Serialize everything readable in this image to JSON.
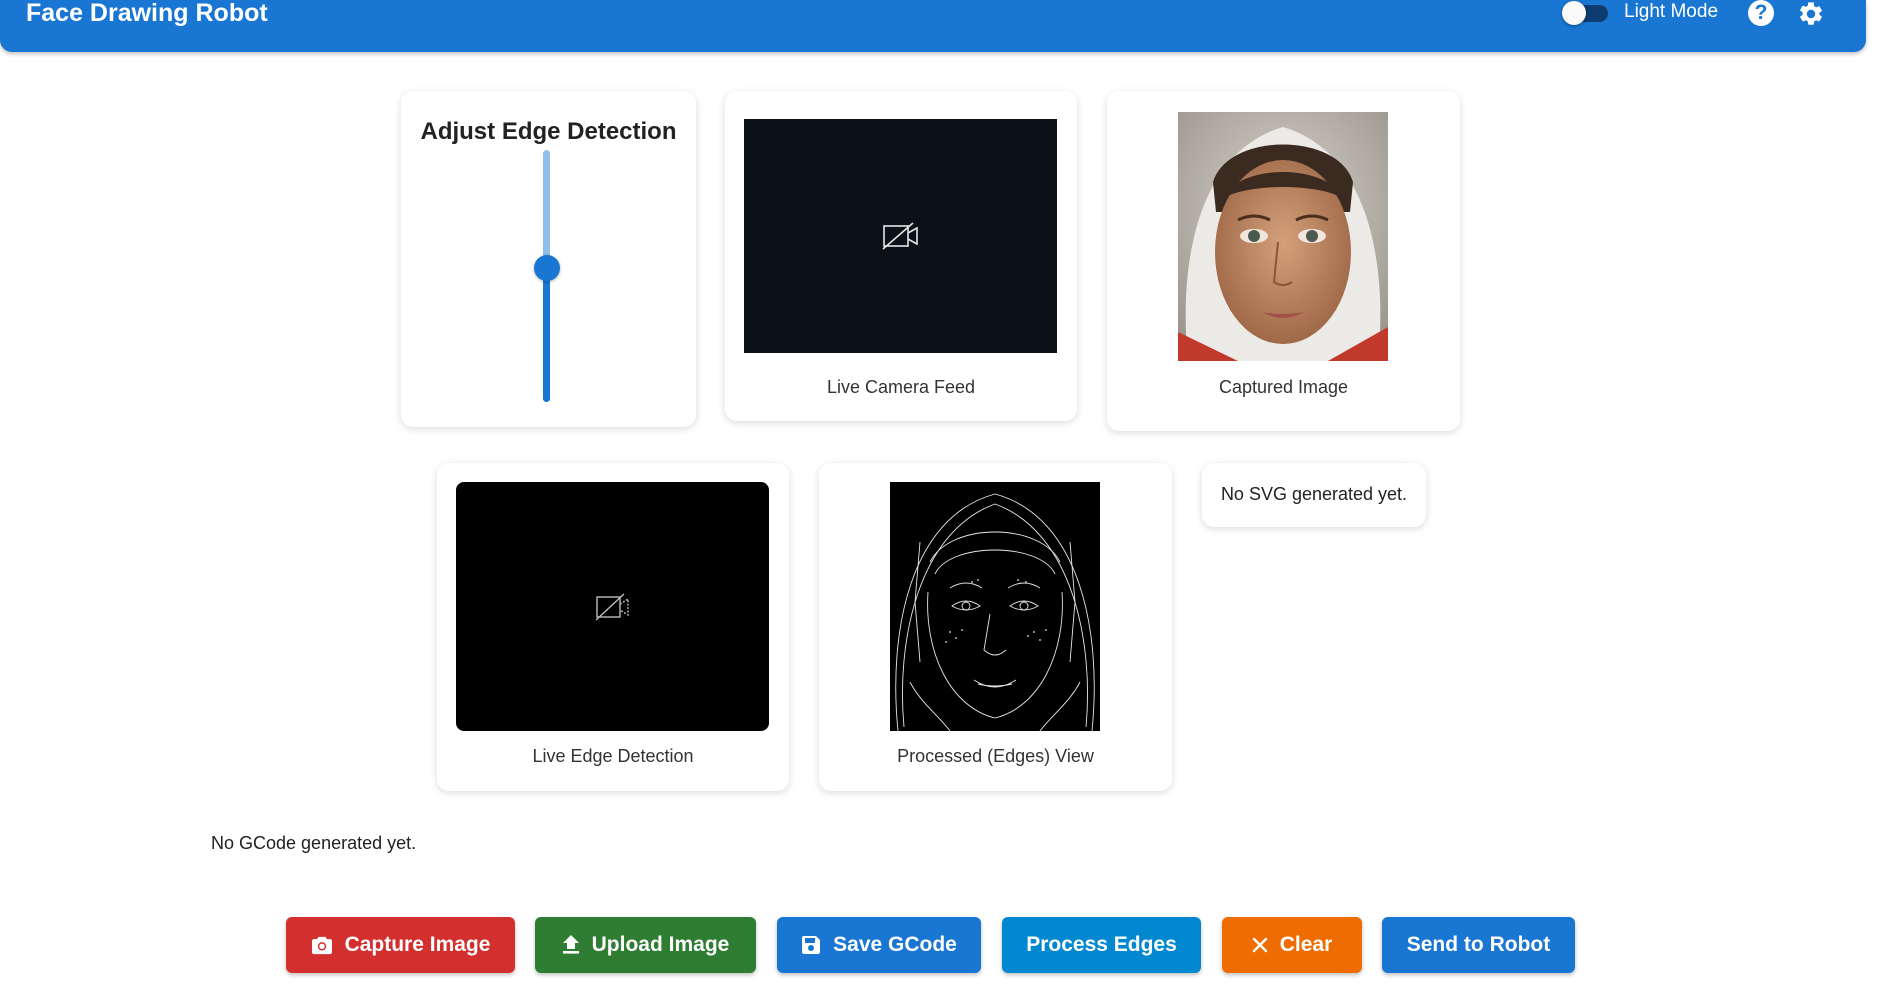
{
  "header": {
    "title": "Face Drawing Robot",
    "theme_label": "Light Mode",
    "help_glyph": "?",
    "icons": {
      "help": "help-circle-icon",
      "settings": "gear-icon"
    },
    "color": "#1976d2"
  },
  "slider": {
    "title": "Adjust Edge Detection",
    "value_fraction": 0.55
  },
  "panels": {
    "camera_caption": "Live Camera Feed",
    "captured_caption": "Captured Image",
    "edge_caption": "Live Edge Detection",
    "processed_caption": "Processed (Edges) View",
    "svg_status": "No SVG generated yet.",
    "camera_icon": "camera-off-icon"
  },
  "gcode_status": "No GCode generated yet.",
  "buttons": {
    "capture": {
      "label": "Capture Image",
      "icon": "camera-icon",
      "color": "#d32f2f"
    },
    "upload": {
      "label": "Upload Image",
      "icon": "upload-icon",
      "color": "#2e7d32"
    },
    "save": {
      "label": "Save GCode",
      "icon": "save-icon",
      "color": "#1976d2"
    },
    "process": {
      "label": "Process Edges",
      "color": "#0288d1"
    },
    "clear": {
      "label": "Clear",
      "icon": "close-icon",
      "color": "#ef6c00"
    },
    "send": {
      "label": "Send to Robot",
      "color": "#1976d2"
    }
  }
}
